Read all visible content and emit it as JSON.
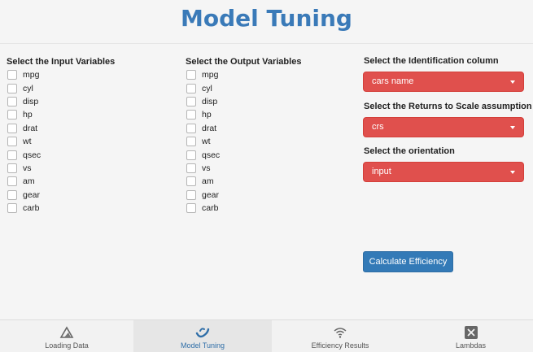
{
  "header": {
    "title": "Model Tuning"
  },
  "input_vars": {
    "label": "Select the Input Variables",
    "options": [
      "mpg",
      "cyl",
      "disp",
      "hp",
      "drat",
      "wt",
      "qsec",
      "vs",
      "am",
      "gear",
      "carb"
    ]
  },
  "output_vars": {
    "label": "Select the Output Variables",
    "options": [
      "mpg",
      "cyl",
      "disp",
      "hp",
      "drat",
      "wt",
      "qsec",
      "vs",
      "am",
      "gear",
      "carb"
    ]
  },
  "id_column": {
    "label": "Select the Identification column",
    "value": "cars name"
  },
  "rts": {
    "label": "Select the Returns to Scale assumption",
    "value": "crs"
  },
  "orientation": {
    "label": "Select the orientation",
    "value": "input"
  },
  "actions": {
    "calculate_label": "Calculate Efficiency"
  },
  "nav": {
    "tabs": [
      {
        "label": "Loading Data",
        "icon": "mountain-icon"
      },
      {
        "label": "Model Tuning",
        "icon": "wave-icon",
        "active": true
      },
      {
        "label": "Efficiency Results",
        "icon": "wifi-icon"
      },
      {
        "label": "Lambdas",
        "icon": "tools-icon"
      }
    ]
  },
  "colors": {
    "title": "#3a7ab8",
    "select_bg": "#e0504d",
    "button_bg": "#337ab7",
    "active_tab_label": "#2f6ea8"
  }
}
